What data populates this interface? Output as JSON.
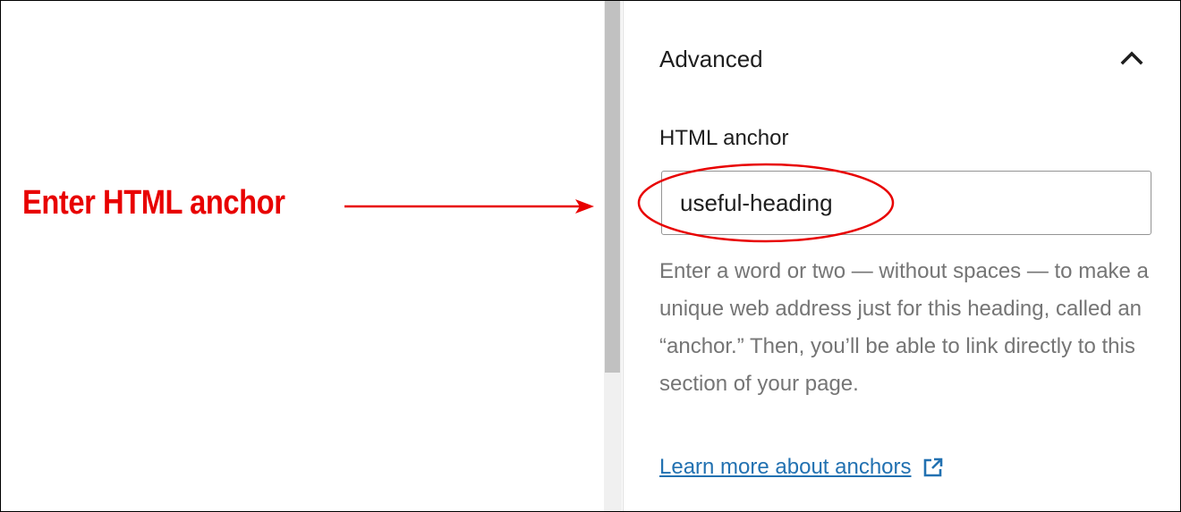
{
  "annotation": {
    "callout_text": "Enter HTML anchor",
    "callout_color": "#e80000"
  },
  "panel": {
    "title": "Advanced",
    "collapse_icon": "chevron-up-icon",
    "field_label": "HTML anchor",
    "input_value": "useful-heading",
    "help_text": "Enter a word or two — without spaces — to make a unique web address just for this heading, called an “anchor.” Then, you’ll be able to link directly to this section of your page.",
    "link_text": "Learn more about anchors",
    "link_icon": "external-link-icon",
    "link_color": "#2271b1"
  }
}
